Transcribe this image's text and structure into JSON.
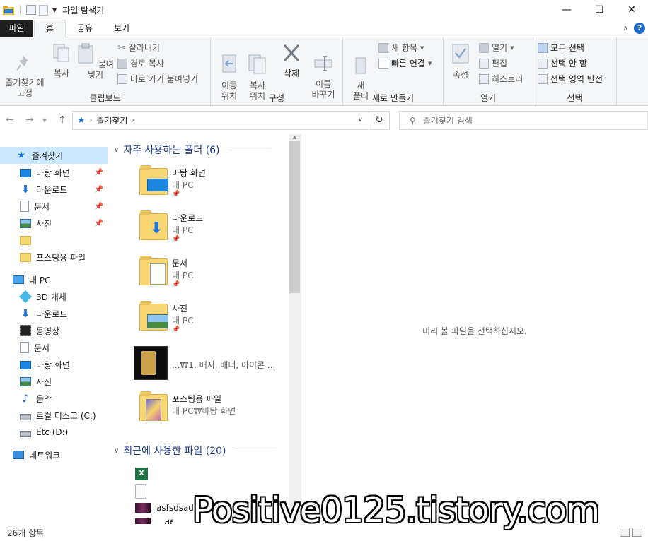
{
  "window": {
    "title": "파일 탐색기",
    "controls": {
      "minimize": "—",
      "maximize": "☐",
      "close": "✕"
    }
  },
  "ribbon_tabs": [
    "파일",
    "홈",
    "공유",
    "보기"
  ],
  "ribbon": {
    "clipboard": {
      "label": "클립보드",
      "pin": "즐겨찾기에\n고정",
      "copy": "복사",
      "paste": "붙여넣기",
      "cut": "잘라내기",
      "copy_path": "경로 복사",
      "paste_shortcut": "바로 가기 붙여넣기"
    },
    "organize": {
      "label": "구성",
      "move_to": "이동\n위치",
      "copy_to": "복사\n위치",
      "delete": "삭제",
      "rename": "이름\n바꾸기"
    },
    "new": {
      "label": "새로 만들기",
      "new_folder": "새\n폴더",
      "new_item": "새 항목",
      "easy_access": "빠른 연결"
    },
    "open": {
      "label": "열기",
      "properties": "속성",
      "open": "열기",
      "edit": "편집",
      "history": "히스토리"
    },
    "select": {
      "label": "선택",
      "select_all": "모두 선택",
      "select_none": "선택 안 함",
      "invert": "선택 영역 반전"
    }
  },
  "address": {
    "crumb": "즐겨찾기",
    "search_placeholder": "즐겨찾기 검색"
  },
  "nav": {
    "quick_access": "즐겨찾기",
    "qa_items": [
      "바탕 화면",
      "다운로드",
      "문서",
      "사진",
      "",
      "포스팅용 파일"
    ],
    "this_pc": "내 PC",
    "pc_items": [
      "3D 개체",
      "다운로드",
      "동영상",
      "문서",
      "바탕 화면",
      "사진",
      "음악",
      "로컬 디스크 (C:)",
      "Etc (D:)"
    ],
    "network": "네트워크"
  },
  "frequent": {
    "header": "자주 사용하는 폴더 (6)",
    "items": [
      {
        "name": "바탕 화면",
        "location": "내 PC"
      },
      {
        "name": "다운로드",
        "location": "내 PC"
      },
      {
        "name": "문서",
        "location": "내 PC"
      },
      {
        "name": "사진",
        "location": "내 PC"
      },
      {
        "name": "...₩1. 배지, 배너, 아이콘 ...",
        "location": ""
      },
      {
        "name": "포스팅용 파일",
        "location": "내 PC₩바탕 화면"
      }
    ]
  },
  "recent": {
    "header": "최근에 사용한 파일 (20)",
    "items": [
      "",
      "",
      "asfsdsad.p",
      "...df"
    ]
  },
  "preview": {
    "message": "미리 볼 파일을 선택하십시오."
  },
  "status": {
    "count": "26개 항목"
  },
  "watermark": "Positive0125.tistory.com",
  "colors": {
    "accent": "#1e73d6",
    "selection": "#cce8ff",
    "section_header": "#1e3a8a"
  }
}
